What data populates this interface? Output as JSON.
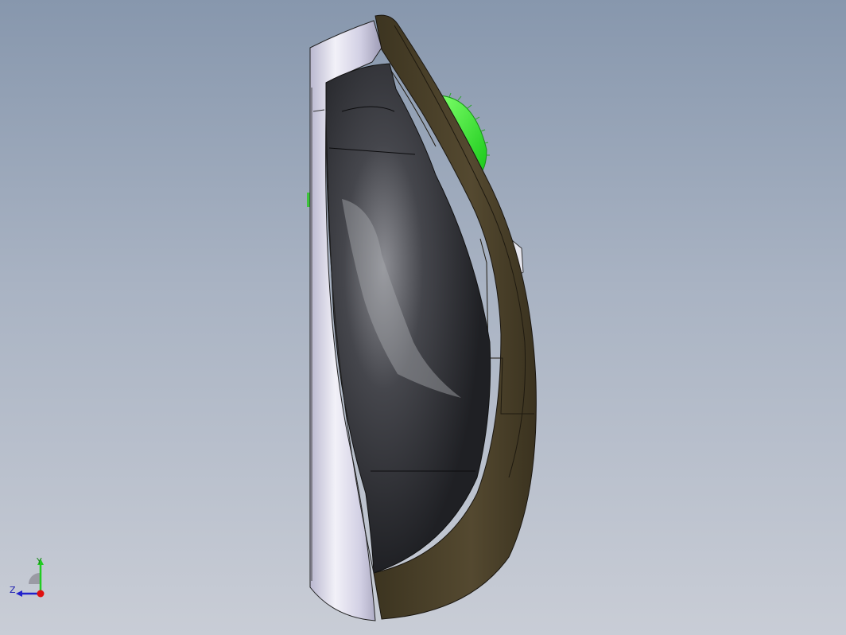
{
  "viewport": {
    "background_top": "#8797ad",
    "background_bottom": "#c9cdd6"
  },
  "model": {
    "description_icon": "computer-mouse-3d-model",
    "shell_color": "#4a4028",
    "side_color": "#d8d6e6",
    "top_color": "#2b2c30",
    "wheel_color": "#3ff03f"
  },
  "triad": {
    "y_label": "Y",
    "z_label": "Z",
    "y_color": "#22cc22",
    "z_color": "#2222cc",
    "x_color": "#e01010"
  }
}
